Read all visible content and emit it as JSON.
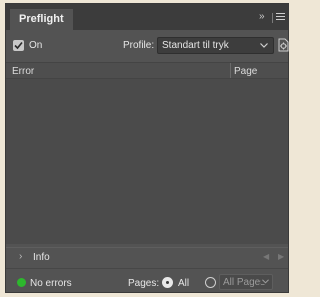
{
  "panel": {
    "tab_title": "Preflight",
    "collapse_glyph": "»"
  },
  "controls": {
    "enabled_checked": true,
    "on_label": "On",
    "profile_label": "Profile:",
    "profile_value": "Standart til tryk"
  },
  "table": {
    "columns": [
      "Error",
      "Page"
    ],
    "rows": []
  },
  "info": {
    "label": "Info"
  },
  "status": {
    "text": "No errors",
    "color": "#2db82d"
  },
  "pages": {
    "label": "Pages:",
    "all_label": "All",
    "range_placeholder": "All Pages",
    "selected": "All"
  },
  "icons": {
    "tab_menu": "hamburger-menu-icon",
    "profile": "define-profiles-icon",
    "info": "chevron-right-icon"
  }
}
